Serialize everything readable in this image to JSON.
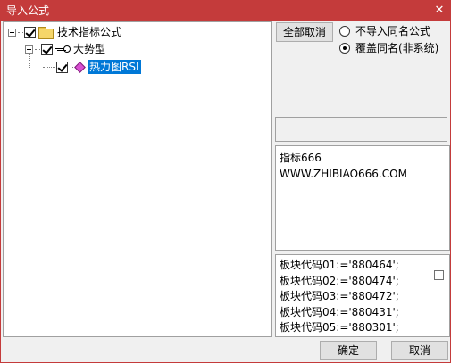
{
  "window": {
    "title": "导入公式",
    "close_glyph": "✕"
  },
  "tree": {
    "root": {
      "label": "技术指标公式",
      "checked": true,
      "expanded": true
    },
    "group": {
      "label": "大势型",
      "checked": true,
      "expanded": true
    },
    "item": {
      "label": "热力图RSI",
      "checked": true,
      "selected": true
    }
  },
  "options": {
    "cancel_all_label": "全部取消",
    "radio_no_import": "不导入同名公式",
    "radio_overwrite": "覆盖同名(非系统)",
    "selected": "overwrite"
  },
  "description": {
    "line1": "指标666",
    "line2": "WWW.ZHIBIAO666.COM"
  },
  "code_lines": [
    "板块代码01:='880464';",
    "板块代码02:='880474';",
    "板块代码03:='880472';",
    "板块代码04:='880431';",
    "板块代码05:='880301';"
  ],
  "buttons": {
    "ok_label": "确定",
    "cancel_label": "取消"
  },
  "colors": {
    "titlebar": "#c43b3b",
    "selection": "#0078d7"
  }
}
